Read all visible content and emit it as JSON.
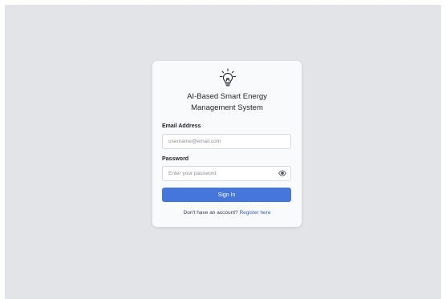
{
  "app": {
    "title_line1": "AI-Based Smart Energy",
    "title_line2": "Management System",
    "logo_icon": "lightbulb-icon"
  },
  "form": {
    "email_label": "Email Address",
    "email_placeholder": "username@email.com",
    "email_value": "",
    "password_label": "Password",
    "password_placeholder": "Enter your password",
    "password_value": "",
    "show_password_icon": "eye-icon",
    "signin_label": "Sign In"
  },
  "footer": {
    "prompt": "Don't have an account?",
    "register_link": "Register here"
  },
  "colors": {
    "background": "#e3e4e8",
    "card": "#f9fafb",
    "primary": "#4577db",
    "link": "#2f5fc8",
    "text": "#1f2329"
  }
}
